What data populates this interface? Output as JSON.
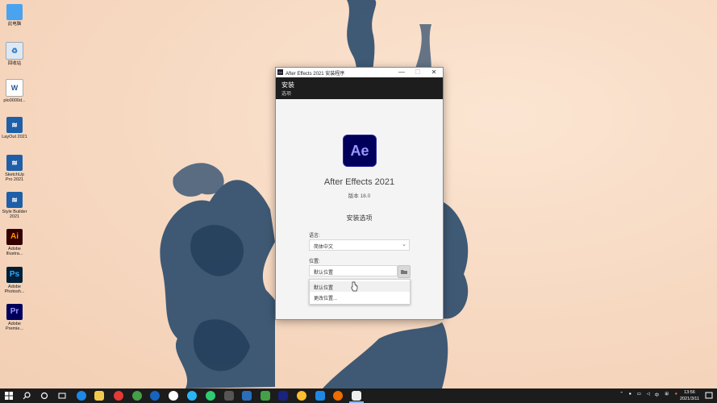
{
  "desktop": {
    "icons": [
      {
        "label": "此电脑",
        "icon": "computer-icon",
        "color": "#4aa3ee"
      },
      {
        "label": "回收站",
        "icon": "recycle-bin-icon",
        "color": "#dfe8f0"
      },
      {
        "label": "plo0000d...",
        "icon": "word-document-icon",
        "color": "#ffffff"
      },
      {
        "label": "LayOut 2021",
        "icon": "layout-app-icon",
        "color": "#1f5fa8"
      },
      {
        "label": "SketchUp Pro 2021",
        "icon": "sketchup-app-icon",
        "color": "#1f5fa8"
      },
      {
        "label": "Style Builder 2021",
        "icon": "style-builder-app-icon",
        "color": "#1f5fa8"
      },
      {
        "label": "Adobe Illustra...",
        "icon": "illustrator-app-icon",
        "text": "Ai",
        "color": "#330000",
        "fg": "#ff9a00"
      },
      {
        "label": "Adobe Photosh...",
        "icon": "photoshop-app-icon",
        "text": "Ps",
        "color": "#001e36",
        "fg": "#31a8ff"
      },
      {
        "label": "Adobe Premie...",
        "icon": "premiere-app-icon",
        "text": "Pr",
        "color": "#00005b",
        "fg": "#9999ff"
      }
    ]
  },
  "window": {
    "title": "After Effects 2021 安装程序",
    "app_icon_text": "Ae",
    "controls": {
      "minimize": "—",
      "maximize": "☐",
      "close": "✕"
    },
    "header": {
      "title": "安装",
      "subtitle": "选项"
    },
    "logo_text": "Ae",
    "product_name": "After Effects 2021",
    "version": "版本 18.0",
    "options_title": "安装选项",
    "language": {
      "label": "语言:",
      "value": "简体中文"
    },
    "location": {
      "label": "位置:",
      "value": "默认位置"
    },
    "dropdown_options": [
      "默认位置",
      "更改位置..."
    ]
  },
  "taskbar": {
    "clock_time": "13:56",
    "clock_date": "2021/3/11",
    "ime": "中",
    "tray_icons": [
      "chevron-up-icon",
      "microphone-icon",
      "network-icon",
      "volume-icon",
      "ime-icon",
      "security-icon"
    ]
  },
  "colors": {
    "ae_bg": "#00005b",
    "ae_fg": "#9999ff",
    "header_bg": "#1d1d1d",
    "taskbar_bg": "#1c1c1c"
  }
}
